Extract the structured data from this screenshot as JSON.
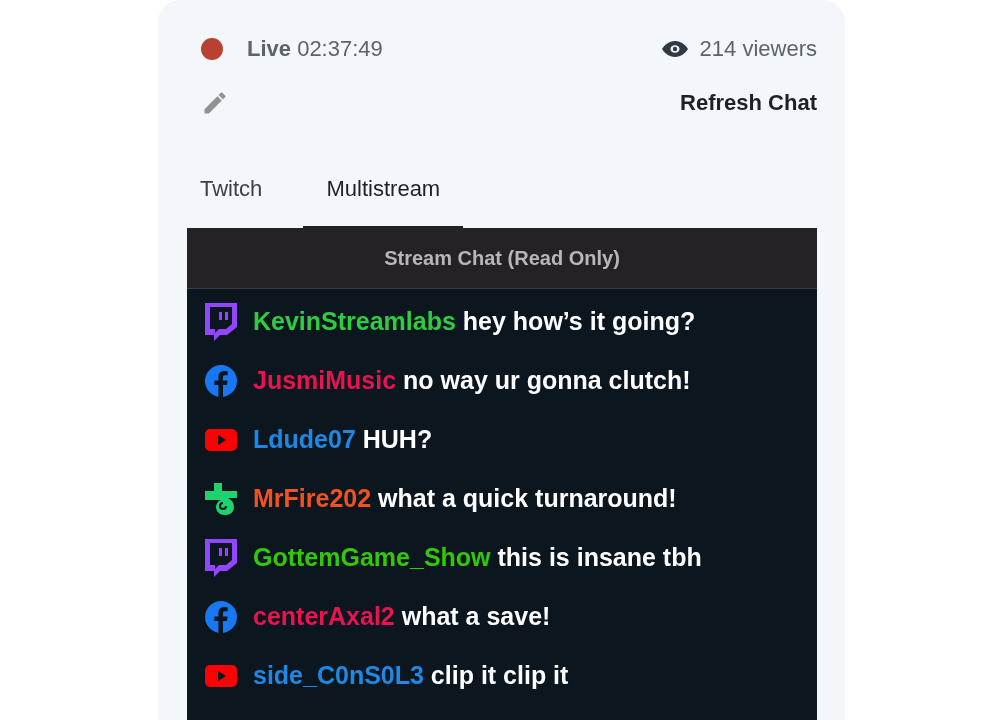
{
  "status": {
    "live_label": "Live",
    "time": "02:37:49",
    "viewers": "214 viewers"
  },
  "refresh_button": "Refresh Chat",
  "tabs": [
    {
      "label": "Twitch",
      "selected": false
    },
    {
      "label": "Multistream",
      "selected": true
    }
  ],
  "chat": {
    "header": "Stream Chat (Read Only)",
    "messages": [
      {
        "kind": "twitch",
        "user": "KevinStreamlabs",
        "color": "#2ecc40",
        "text": "hey how’s it going?"
      },
      {
        "kind": "facebook",
        "user": "JusmiMusic",
        "color": "#e8134f",
        "text": "no way ur gonna clutch!"
      },
      {
        "kind": "youtube",
        "user": "Ldude07",
        "color": "#1e88e5",
        "text": "HUH?"
      },
      {
        "kind": "trovo",
        "user": "MrFire202",
        "color": "#f4511e",
        "text": "what a quick turnaround!"
      },
      {
        "kind": "twitch",
        "user": "GottemGame_Show",
        "color": "#32c80a",
        "text": "this is insane tbh"
      },
      {
        "kind": "facebook",
        "user": "centerAxal2",
        "color": "#e8134f",
        "text": "what a save!"
      },
      {
        "kind": "youtube",
        "user": "side_C0nS0L3",
        "color": "#1e88e5",
        "text": "clip it clip it"
      }
    ]
  }
}
